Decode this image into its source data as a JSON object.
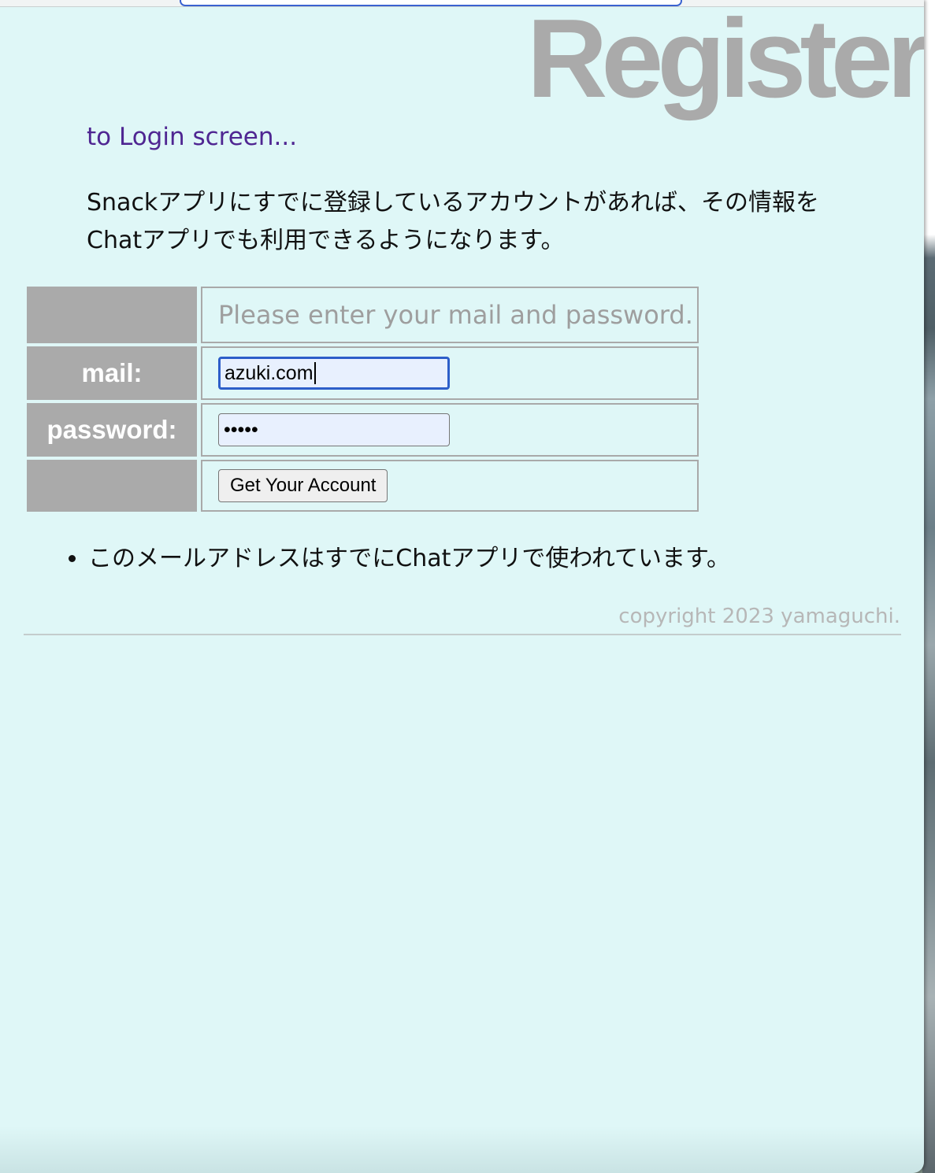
{
  "page": {
    "title": "Register",
    "login_link": "to Login screen...",
    "description_lines": [
      "Snackアプリにすでに登録しているアカウントがあれば、その情報を",
      "Chatアプリでも利用できるようになります。"
    ]
  },
  "form": {
    "hint": "Please enter your mail and password.",
    "mail_label": "mail:",
    "mail_value": "azuki.com",
    "password_label": "password:",
    "password_value": "•••••",
    "submit_label": "Get Your Account"
  },
  "errors": [
    "このメールアドレスはすでにChatアプリで使われています。"
  ],
  "footer": {
    "copyright": "copyright 2023 yamaguchi."
  },
  "colors": {
    "background": "#dff7f7",
    "title": "#aaaaaa",
    "label_cell": "#aaaaaa",
    "link": "#4f2692",
    "focus_border": "#2d5ec9"
  }
}
